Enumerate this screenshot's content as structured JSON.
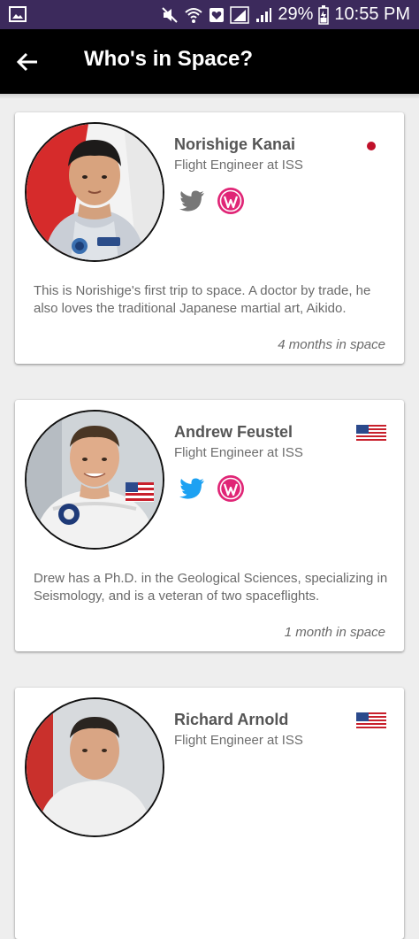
{
  "status_bar": {
    "battery": "29%",
    "time": "10:55 PM"
  },
  "header": {
    "title": "Who's in Space?",
    "back_icon": "arrow-left-icon"
  },
  "colors": {
    "status_bar": "#3c2a5c",
    "app_bar": "#000000",
    "twitter_grey": "#777777",
    "twitter_blue": "#1da1f2",
    "wordpress_pink": "#e02576"
  },
  "astronauts": [
    {
      "name": "Norishige Kanai",
      "role": "Flight Engineer at ISS",
      "bio": "This is Norishige's first trip to space. A doctor by trade, he also loves the traditional Japanese martial art, Aikido.",
      "duration": "4 months in space",
      "flag": "japan-flag-icon",
      "twitter_active": false
    },
    {
      "name": "Andrew Feustel",
      "role": "Flight Engineer at ISS",
      "bio": "Drew has a Ph.D. in the Geological Sciences, specializing in Seismology, and is a veteran of two spaceflights.",
      "duration": "1 month in space",
      "flag": "us-flag-icon",
      "twitter_active": true
    },
    {
      "name": "Richard Arnold",
      "role": "Flight Engineer at ISS",
      "flag": "us-flag-icon"
    }
  ]
}
